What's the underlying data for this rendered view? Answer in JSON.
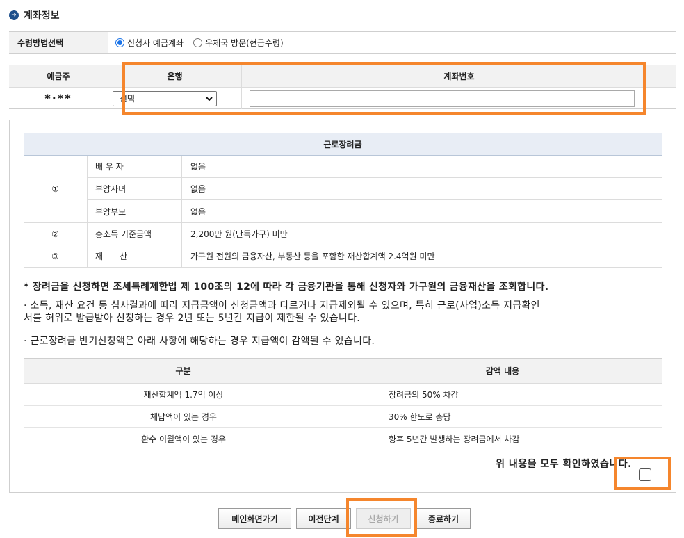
{
  "section": {
    "title": "계좌정보"
  },
  "method": {
    "label": "수령방법선택",
    "options": [
      {
        "label": "신청자 예금계좌",
        "selected": true
      },
      {
        "label": "우체국 방문(현금수령)",
        "selected": false
      }
    ]
  },
  "account": {
    "col_holder": "예금주",
    "col_bank": "은행",
    "col_number": "계좌번호",
    "holder_value": "*·**",
    "bank_selected": "-선택-",
    "number_value": ""
  },
  "grant": {
    "title": "근로장려금",
    "group1": {
      "num": "①",
      "rows": [
        {
          "label": "배 우 자",
          "value": "없음"
        },
        {
          "label": "부양자녀",
          "value": "없음"
        },
        {
          "label": "부양부모",
          "value": "없음"
        }
      ]
    },
    "row2": {
      "num": "②",
      "label": "총소득 기준금액",
      "value": "2,200만 원(단독가구) 미만"
    },
    "row3": {
      "num": "③",
      "label": "재　　산",
      "value": "가구원 전원의 금융자산, 부동산 등을 포함한 재산합계액 2.4억원 미만"
    }
  },
  "notices": {
    "n1": "* 장려금을 신청하면 조세특례제한법 제 100조의 12에 따라 각 금융기관을 통해 신청자와 가구원의 금융재산을 조회합니다.",
    "n2_line1": "· 소득, 재산 요건 등 심사결과에 따라 지급금액이 신청금액과 다르거나 지급제외될 수 있으며, 특히 근로(사업)소득 지급확인",
    "n2_line2": "서를 허위로 발급받아 신청하는 경우 2년 또는 5년간 지급이 제한될 수 있습니다.",
    "n3": "· 근로장려금 반기신청액은 아래 사항에 해당하는 경우 지급액이 감액될 수 있습니다."
  },
  "reduce": {
    "col_a": "구분",
    "col_b": "감액 내용",
    "rows": [
      {
        "a": "재산합계액 1.7억 이상",
        "b": "장려금의 50% 차감"
      },
      {
        "a": "체납액이 있는 경우",
        "b": "30% 한도로 충당"
      },
      {
        "a": "환수 이월액이 있는 경우",
        "b": "향후 5년간 발생하는 장려금에서 차감"
      }
    ]
  },
  "confirm": {
    "text": "위 내용을 모두 확인하였습니다.",
    "checked": false
  },
  "buttons": {
    "main": "메인화면가기",
    "prev": "이전단계",
    "apply": "신청하기",
    "close": "종료하기"
  },
  "colors": {
    "highlight": "#f5862d",
    "header_blue": "#e8edf5",
    "accent": "#1d4f8c"
  }
}
